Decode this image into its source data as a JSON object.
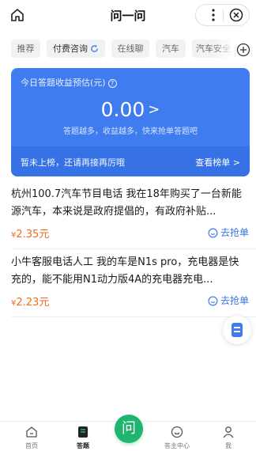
{
  "header": {
    "title": "问一问"
  },
  "tabs": [
    {
      "label": "推荐"
    },
    {
      "label": "付费咨询"
    },
    {
      "label": "在线聊"
    },
    {
      "label": "汽车"
    },
    {
      "label": "汽车安全"
    }
  ],
  "earnings": {
    "label": "今日答题收益预估(元)",
    "help_symbol": "?",
    "amount": "0.00",
    "amount_arrow": ">",
    "hint": "答题越多，收益越多，快来抢单答题吧",
    "rank_status": "暂未上榜，还请再接再厉哦",
    "rank_link": "查看榜单 >"
  },
  "questions": [
    {
      "text": "杭州100.7汽车节目电话 我在18年购买了一台新能源汽车，本来说是政府提倡的，有政府补贴...",
      "currency": "¥",
      "price": "2.35元",
      "action": "去抢单"
    },
    {
      "text": "小牛客服电话人工 我的车是N1s pro，充电器是快充的，能不能用N1动力版4A的充电器充电...",
      "currency": "¥",
      "price": "2.23元",
      "action": "去抢单"
    }
  ],
  "bottom_nav": {
    "home": "首页",
    "answer": "答题",
    "center": "问",
    "owner": "答主中心",
    "me": "我"
  },
  "colors": {
    "accent": "#3f7cf0",
    "price": "#f26a1b",
    "center_button": "#1fb56f"
  },
  "icons": [
    "home-icon",
    "more-icon",
    "close-icon",
    "refresh-icon",
    "add-icon",
    "chat-icon",
    "document-icon",
    "home-nav-icon",
    "answer-nav-icon",
    "owner-center-icon",
    "profile-icon"
  ]
}
